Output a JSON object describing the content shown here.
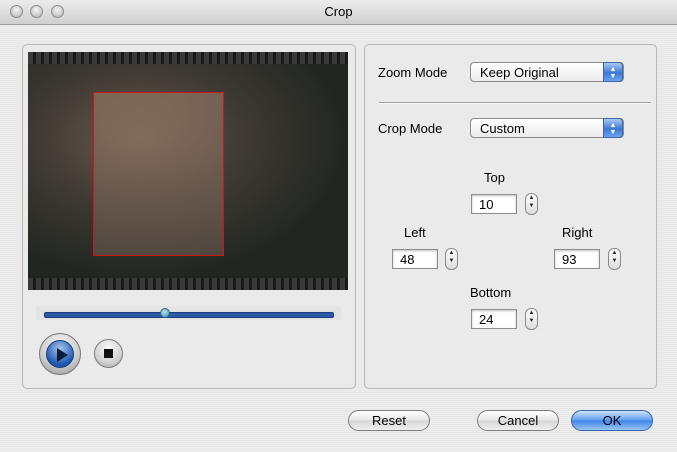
{
  "window": {
    "title": "Crop"
  },
  "preview": {
    "progress": 0.42
  },
  "zoom_mode": {
    "label": "Zoom Mode",
    "value": "Keep Original"
  },
  "crop_mode": {
    "label": "Crop Mode",
    "value": "Custom"
  },
  "crop": {
    "top": {
      "label": "Top",
      "value": "10"
    },
    "left": {
      "label": "Left",
      "value": "48"
    },
    "right": {
      "label": "Right",
      "value": "93"
    },
    "bottom": {
      "label": "Bottom",
      "value": "24"
    }
  },
  "buttons": {
    "reset": "Reset",
    "cancel": "Cancel",
    "ok": "OK"
  },
  "icons": {
    "play": "play-icon",
    "stop": "stop-icon",
    "popup": "popup-arrows-icon",
    "stepper": "stepper-arrows-icon"
  },
  "colors": {
    "crop_rect": "#d01515",
    "accent": "#3d84ea"
  }
}
